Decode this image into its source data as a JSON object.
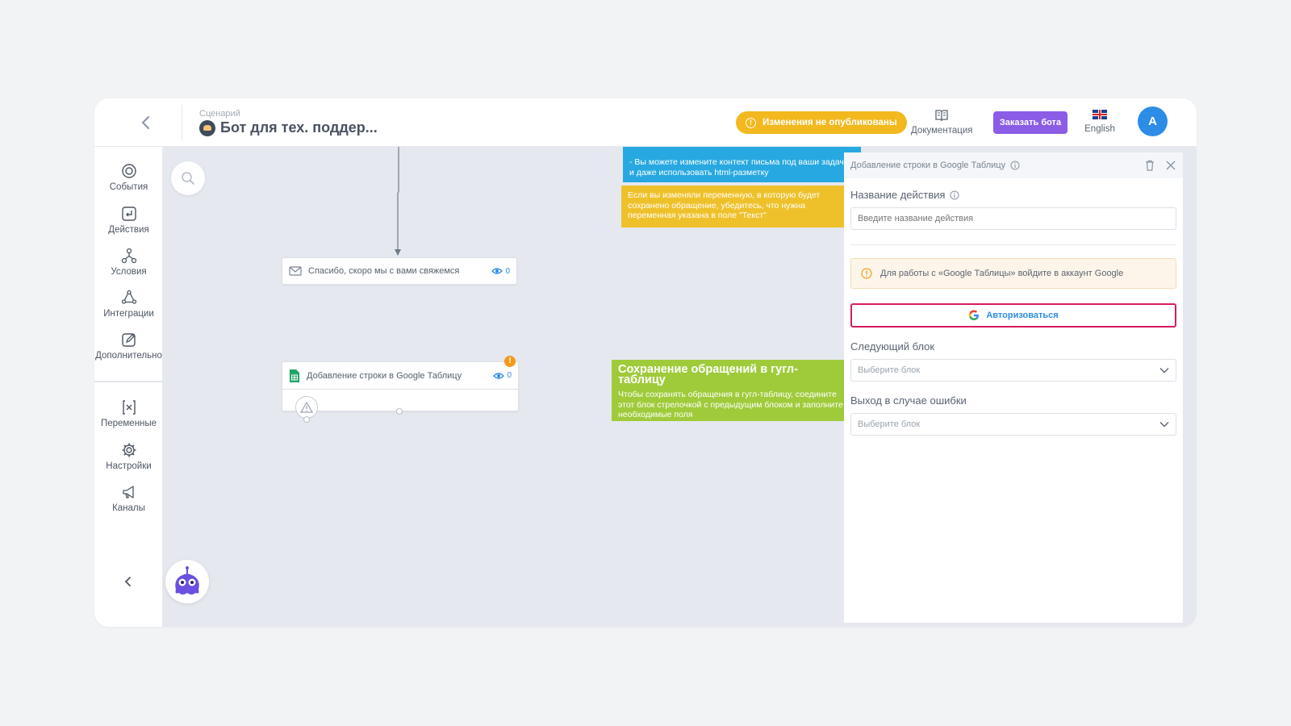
{
  "header": {
    "scenario_caption": "Сценарий",
    "scenario_title": "Бот для тех. поддер...",
    "publish_badge": "Изменения не опубликованы",
    "docs_label": "Документация",
    "order_button": "Заказать бота",
    "language": "English",
    "avatar_letter": "A"
  },
  "sidebar": {
    "items": [
      {
        "label": "События",
        "icon": "events-icon"
      },
      {
        "label": "Действия",
        "icon": "actions-icon"
      },
      {
        "label": "Условия",
        "icon": "conditions-icon"
      },
      {
        "label": "Интеграции",
        "icon": "integrations-icon"
      },
      {
        "label": "Дополнительно",
        "icon": "additional-icon"
      },
      {
        "label": "Переменные",
        "icon": "variables-icon"
      },
      {
        "label": "Настройки",
        "icon": "settings-icon"
      },
      {
        "label": "Каналы",
        "icon": "channels-icon"
      }
    ]
  },
  "canvas": {
    "note_blue": "- Вы можете измените контект письма под ваши задачи и даже использовать html-разметку",
    "note_yellow": "Если вы изменяли переменную, в которую будет сохранено обращение, убедитесь, что нужна переменная указана в поле \"Текст\"",
    "note_green_title": "Сохранение обращений в гугл-таблицу",
    "note_green_text": "Чтобы сохранять обращения в гугл-таблицу, соедините этот блок стрелочкой с предыдущим блоком и заполните необходимые поля",
    "node_message": {
      "label": "Спасибо, скоро мы с вами свяжемся",
      "views": "0"
    },
    "node_sheets": {
      "label": "Добавление строки в Google Таблицу",
      "views": "0",
      "error_mark": "!"
    }
  },
  "panel": {
    "title": "Добавление строки в Google Таблицу",
    "action_name_label": "Название действия",
    "action_name_placeholder": "Введите название действия",
    "alert_text": "Для работы с «Google Таблицы» войдите в аккаунт Google",
    "auth_button": "Авторизоваться",
    "next_block_label": "Следующий блок",
    "next_block_value": "Выберите блок",
    "error_exit_label": "Выход в случае ошибки",
    "error_exit_value": "Выберите блок"
  },
  "colors": {
    "accent_blue": "#2d8ce6",
    "publish_yellow": "#f2b81d",
    "order_purple": "#8b5ce6",
    "note_blue": "#28a8e0",
    "note_yellow": "#eec12b",
    "note_green": "#9fcb3b",
    "auth_border": "#d81b60"
  }
}
